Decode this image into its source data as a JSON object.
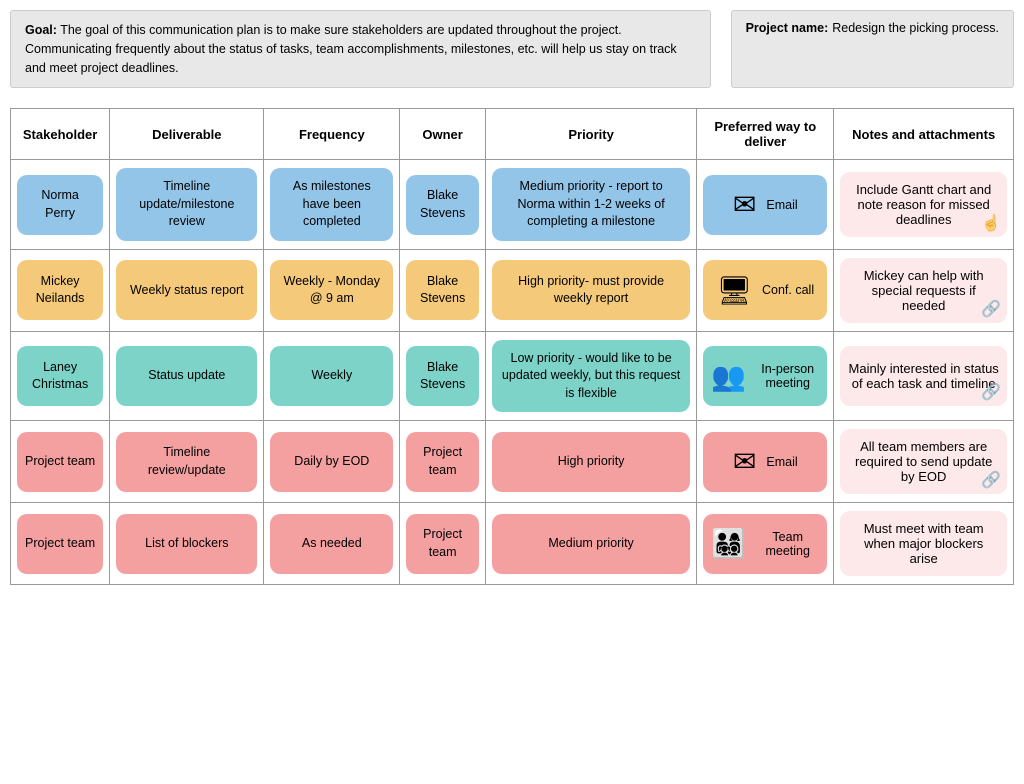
{
  "header": {
    "goal_label": "Goal:",
    "goal_text": "The goal of this communication plan is to make sure stakeholders are updated throughout the project. Communicating frequently about the status of tasks, team accomplishments, milestones, etc. will help us stay on track and meet project deadlines.",
    "project_name_label": "Project name:",
    "project_name_value": "Redesign the picking process."
  },
  "columns": [
    "Stakeholder",
    "Deliverable",
    "Frequency",
    "Owner",
    "Priority",
    "Preferred way to deliver",
    "Notes and attachments"
  ],
  "rows": [
    {
      "stakeholder": "Norma Perry",
      "deliverable": "Timeline update/milestone review",
      "frequency": "As milestones have been completed",
      "owner": "Blake Stevens",
      "priority": "Medium priority - report to Norma within 1-2 weeks of completing a milestone",
      "deliver_icon": "email",
      "deliver_label": "Email",
      "notes": "Include Gantt chart and note reason for missed deadlines",
      "notes_icon": "hand",
      "row_color": "blue"
    },
    {
      "stakeholder": "Mickey Neilands",
      "deliverable": "Weekly status report",
      "frequency": "Weekly - Monday @ 9 am",
      "owner": "Blake Stevens",
      "priority": "High priority- must provide weekly report",
      "deliver_icon": "laptop",
      "deliver_label": "Conf. call",
      "notes": "Mickey can help with special requests if needed",
      "notes_icon": "link",
      "row_color": "orange"
    },
    {
      "stakeholder": "Laney Christmas",
      "deliverable": "Status update",
      "frequency": "Weekly",
      "owner": "Blake Stevens",
      "priority": "Low priority - would like to be updated weekly, but this request is flexible",
      "deliver_icon": "people",
      "deliver_label": "In-person meeting",
      "notes": "Mainly interested in status of each task and timeline",
      "notes_icon": "link",
      "row_color": "teal"
    },
    {
      "stakeholder": "Project team",
      "deliverable": "Timeline review/update",
      "frequency": "Daily by EOD",
      "owner": "Project team",
      "priority": "High priority",
      "deliver_icon": "email",
      "deliver_label": "Email",
      "notes": "All team members are required to send update by EOD",
      "notes_icon": "link",
      "row_color": "pink"
    },
    {
      "stakeholder": "Project team",
      "deliverable": "List of blockers",
      "frequency": "As needed",
      "owner": "Project team",
      "priority": "Medium priority",
      "deliver_icon": "group",
      "deliver_label": "Team meeting",
      "notes": "Must meet with team when major blockers arise",
      "notes_icon": "",
      "row_color": "pink"
    }
  ],
  "icons": {
    "email": "✉",
    "laptop": "🖥",
    "people": "👥",
    "group": "👨‍👩‍👧‍👦",
    "hand": "👆",
    "link": "🔗"
  }
}
